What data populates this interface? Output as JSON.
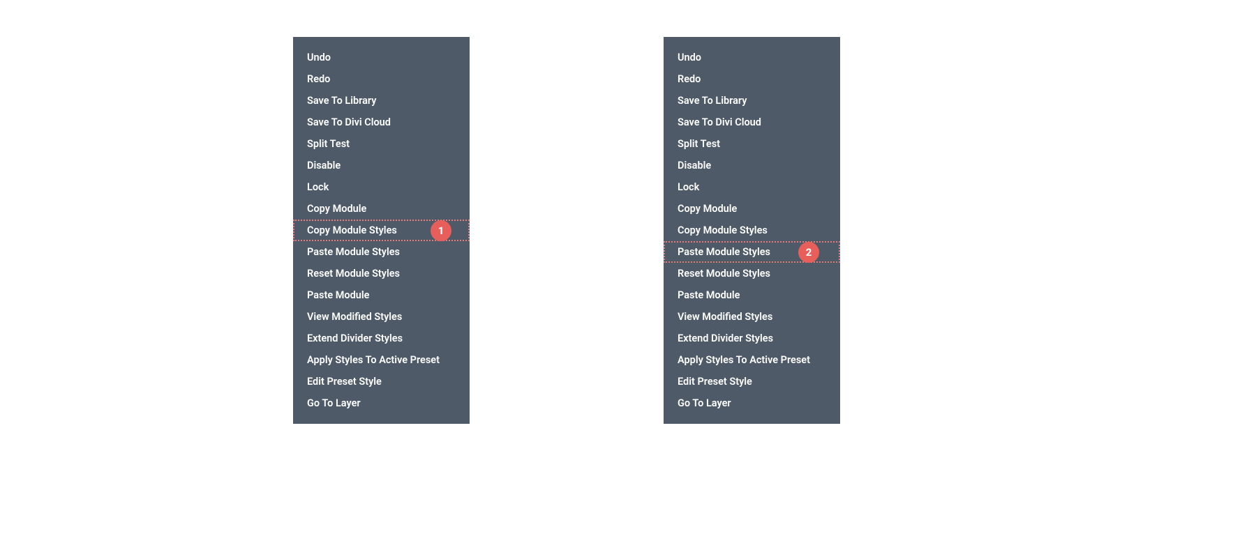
{
  "menu_left": {
    "items": [
      "Undo",
      "Redo",
      "Save To Library",
      "Save To Divi Cloud",
      "Split Test",
      "Disable",
      "Lock",
      "Copy Module",
      "Copy Module Styles",
      "Paste Module Styles",
      "Reset Module Styles",
      "Paste Module",
      "View Modified Styles",
      "Extend Divider Styles",
      "Apply Styles To Active Preset",
      "Edit Preset Style",
      "Go To Layer"
    ],
    "highlighted_index": 8,
    "badge_number": "1"
  },
  "menu_right": {
    "items": [
      "Undo",
      "Redo",
      "Save To Library",
      "Save To Divi Cloud",
      "Split Test",
      "Disable",
      "Lock",
      "Copy Module",
      "Copy Module Styles",
      "Paste Module Styles",
      "Reset Module Styles",
      "Paste Module",
      "View Modified Styles",
      "Extend Divider Styles",
      "Apply Styles To Active Preset",
      "Edit Preset Style",
      "Go To Layer"
    ],
    "highlighted_index": 9,
    "badge_number": "2"
  }
}
